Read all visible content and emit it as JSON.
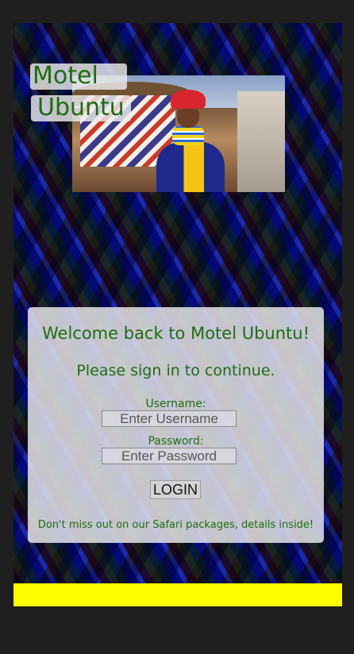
{
  "header": {
    "title_line1": "Motel",
    "title_line2": "Ubuntu"
  },
  "login": {
    "welcome": "Welcome back to Motel Ubuntu!",
    "signin_prompt": "Please sign in to continue.",
    "username_label": "Username:",
    "username_placeholder": "Enter Username",
    "password_label": "Password:",
    "password_placeholder": "Enter Password",
    "login_button": "LOGIN",
    "promo": "Don't miss out on our Safari packages, details inside!"
  },
  "colors": {
    "accent_text": "#1e6b12",
    "footer_bar": "#ffff00",
    "page_background": "#1f1f1f"
  }
}
